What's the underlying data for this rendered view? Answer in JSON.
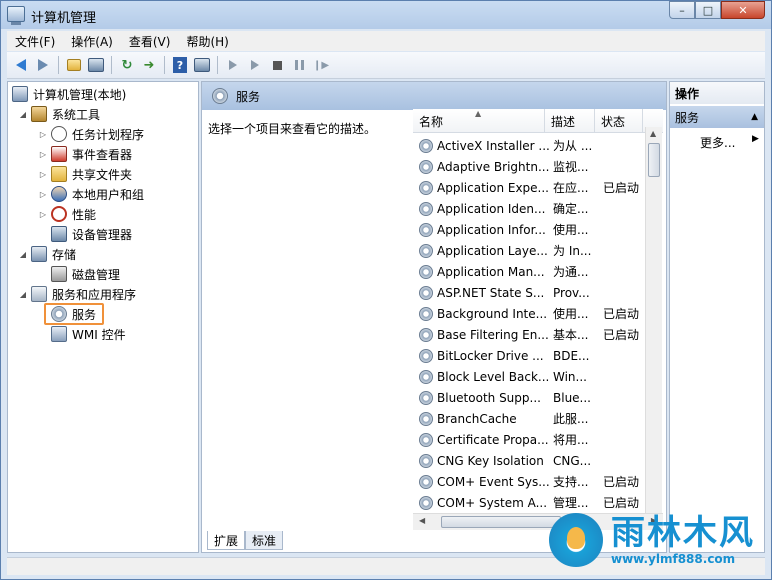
{
  "window": {
    "title": "计算机管理",
    "controls": [
      "–",
      "□",
      "✕"
    ]
  },
  "menu": [
    "文件(F)",
    "操作(A)",
    "查看(V)",
    "帮助(H)"
  ],
  "tree": {
    "root": "计算机管理(本地)",
    "system_tools": "系统工具",
    "task_scheduler": "任务计划程序",
    "event_viewer": "事件查看器",
    "shared_folders": "共享文件夹",
    "local_users": "本地用户和组",
    "performance": "性能",
    "device_manager": "设备管理器",
    "storage": "存储",
    "disk_management": "磁盘管理",
    "services_apps": "服务和应用程序",
    "services": "服务",
    "wmi": "WMI 控件"
  },
  "center": {
    "header": "服务",
    "description_hint": "选择一个项目来查看它的描述。",
    "columns": {
      "name": "名称",
      "desc": "描述",
      "status": "状态"
    },
    "rows": [
      {
        "name": "ActiveX Installer ...",
        "desc": "为从 ...",
        "status": ""
      },
      {
        "name": "Adaptive Brightn...",
        "desc": "监视...",
        "status": ""
      },
      {
        "name": "Application Expe...",
        "desc": "在应...",
        "status": "已启动"
      },
      {
        "name": "Application Iden...",
        "desc": "确定...",
        "status": ""
      },
      {
        "name": "Application Infor...",
        "desc": "使用...",
        "status": ""
      },
      {
        "name": "Application Laye...",
        "desc": "为 In...",
        "status": ""
      },
      {
        "name": "Application Man...",
        "desc": "为通...",
        "status": ""
      },
      {
        "name": "ASP.NET State S...",
        "desc": "Prov...",
        "status": ""
      },
      {
        "name": "Background Inte...",
        "desc": "使用...",
        "status": "已启动"
      },
      {
        "name": "Base Filtering En...",
        "desc": "基本...",
        "status": "已启动"
      },
      {
        "name": "BitLocker Drive ...",
        "desc": "BDE...",
        "status": ""
      },
      {
        "name": "Block Level Back...",
        "desc": "Win...",
        "status": ""
      },
      {
        "name": "Bluetooth Supp...",
        "desc": "Blue...",
        "status": ""
      },
      {
        "name": "BranchCache",
        "desc": "此服...",
        "status": ""
      },
      {
        "name": "Certificate Propa...",
        "desc": "将用...",
        "status": ""
      },
      {
        "name": "CNG Key Isolation",
        "desc": "CNG...",
        "status": ""
      },
      {
        "name": "COM+ Event Sys...",
        "desc": "支持...",
        "status": "已启动"
      },
      {
        "name": "COM+ System A...",
        "desc": "管理...",
        "status": "已启动"
      }
    ],
    "tabs": [
      "扩展",
      "标准"
    ]
  },
  "actions": {
    "title": "操作",
    "group": "服务",
    "more": "更多..."
  },
  "watermark": {
    "name": "雨林木风",
    "url": "www.ylmf888.com"
  }
}
